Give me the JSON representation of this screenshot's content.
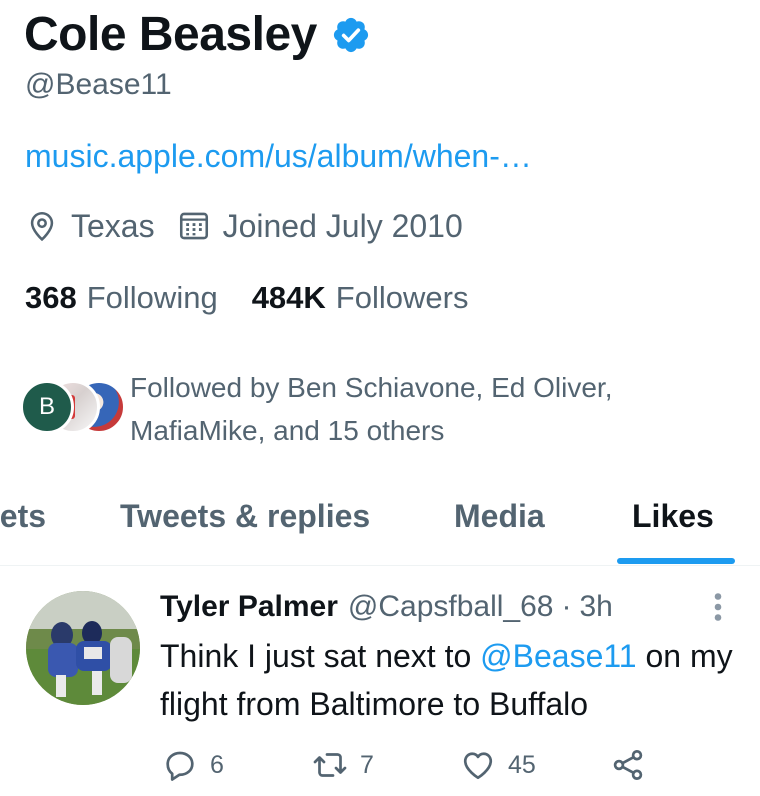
{
  "profile": {
    "name": "Cole Beasley",
    "handle": "@Bease11",
    "link": "music.apple.com/us/album/when-…",
    "location": "Texas",
    "joined": "Joined July 2010",
    "following_count": "368",
    "following_label": "Following",
    "followers_count": "484K",
    "followers_label": "Followers",
    "followed_by_text": "Followed by Ben Schiavone, Ed Oliver, MafiaMike, and 15 others",
    "followed_avatar_initial": "B"
  },
  "tabs": [
    {
      "label": "eets"
    },
    {
      "label": "Tweets & replies"
    },
    {
      "label": "Media"
    },
    {
      "label": "Likes"
    }
  ],
  "active_tab": "Likes",
  "tweet": {
    "author": "Tyler Palmer",
    "handle": "@Capsfball_68",
    "separator": "·",
    "time": "3h",
    "text_before": "Think I just sat next to ",
    "mention": "@Bease11",
    "text_after": " on my flight from Baltimore to Buffalo",
    "replies": "6",
    "retweets": "7",
    "likes": "45"
  },
  "icons": {
    "verified": "verified-badge-icon",
    "location": "location-pin-icon",
    "calendar": "calendar-icon",
    "reply": "reply-icon",
    "retweet": "retweet-icon",
    "like": "heart-icon",
    "share": "share-icon",
    "more": "more-options-icon"
  },
  "colors": {
    "accent": "#1d9bf0",
    "text_primary": "#0f1419",
    "text_secondary": "#536471",
    "avatar_green": "#1f5b4b"
  }
}
